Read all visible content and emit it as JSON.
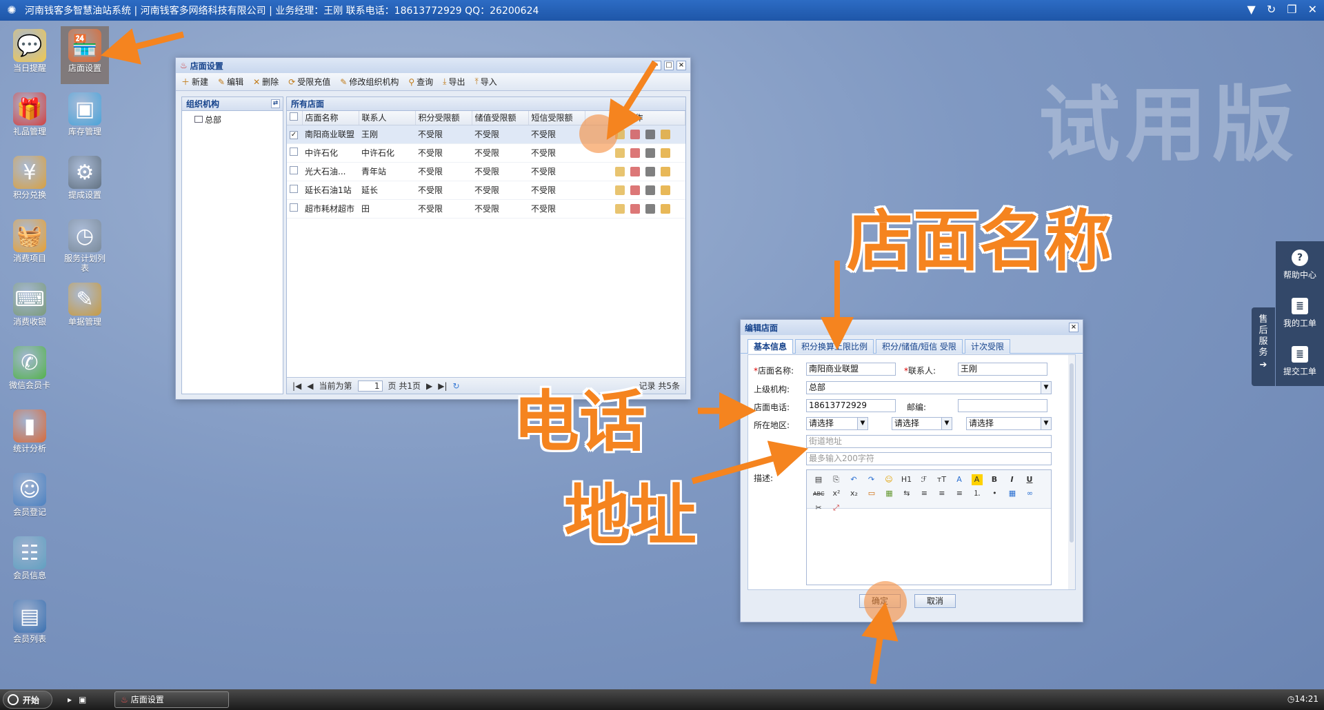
{
  "title_bar": {
    "text": "河南钱客多智慧油站系统 | 河南钱客多网络科技有限公司 | 业务经理：王刚 联系电话：18613772929 QQ：26200624"
  },
  "watermark": "试用版",
  "desktop_icons": [
    {
      "label": "当日提醒",
      "icon": "reminder-icon"
    },
    {
      "label": "店面设置",
      "icon": "store-icon"
    },
    {
      "label": "礼品管理",
      "icon": "gift-icon"
    },
    {
      "label": "库存管理",
      "icon": "inventory-icon"
    },
    {
      "label": "积分兑换",
      "icon": "points-exchange-icon"
    },
    {
      "label": "提成设置",
      "icon": "commission-icon"
    },
    {
      "label": "消费项目",
      "icon": "consume-item-icon"
    },
    {
      "label": "服务计划列表",
      "icon": "service-plan-icon"
    },
    {
      "label": "消费收银",
      "icon": "cashier-icon"
    },
    {
      "label": "单据管理",
      "icon": "receipt-icon"
    },
    {
      "label": "微信会员卡",
      "icon": "wechat-icon"
    },
    {
      "label": "统计分析",
      "icon": "stats-icon"
    },
    {
      "label": "会员登记",
      "icon": "member-register-icon"
    },
    {
      "label": "会员信息",
      "icon": "member-info-icon"
    },
    {
      "label": "会员列表",
      "icon": "member-list-icon"
    }
  ],
  "store_window": {
    "title": "店面设置",
    "toolbar": [
      "新建",
      "编辑",
      "删除",
      "受限充值",
      "修改组织机构",
      "查询",
      "导出",
      "导入"
    ],
    "org_panel_title": "组织机构",
    "org_root": "总部",
    "stores_panel_title": "所有店面",
    "columns": [
      "店面名称",
      "联系人",
      "积分受限额",
      "储值受限额",
      "短信受限额",
      "操作"
    ],
    "rows": [
      {
        "name": "南阳商业联盟",
        "contact": "王刚",
        "points": "不受限",
        "stored": "不受限",
        "sms": "不受限",
        "checked": "✓"
      },
      {
        "name": "中许石化",
        "contact": "中许石化",
        "points": "不受限",
        "stored": "不受限",
        "sms": "不受限",
        "checked": ""
      },
      {
        "name": "光大石油...",
        "contact": "青年站",
        "points": "不受限",
        "stored": "不受限",
        "sms": "不受限",
        "checked": ""
      },
      {
        "name": "延长石油1站",
        "contact": "延长",
        "points": "不受限",
        "stored": "不受限",
        "sms": "不受限",
        "checked": ""
      },
      {
        "name": "超市耗材超市",
        "contact": "田",
        "points": "不受限",
        "stored": "不受限",
        "sms": "不受限",
        "checked": ""
      }
    ],
    "pager": {
      "current_label": "当前为第",
      "page": "1",
      "total_label": "页 共1页",
      "record_info": "记录 共5条"
    }
  },
  "edit_window": {
    "title": "编辑店面",
    "tabs": [
      "基本信息",
      "积分换算上限比例",
      "积分/储值/短信 受限",
      "计次受限"
    ],
    "labels": {
      "store_name": "店面名称:",
      "contact": "联系人:",
      "parent_org": "上级机构:",
      "phone": "店面电话:",
      "zip": "邮编:",
      "region": "所在地区:",
      "description": "描述:"
    },
    "values": {
      "store_name": "南阳商业联盟",
      "contact": "王刚",
      "parent_org": "总部",
      "phone": "18613772929",
      "zip": "",
      "province": "请选择",
      "city": "请选择",
      "district": "请选择"
    },
    "placeholders": {
      "street": "街道地址",
      "remark": "最多输入200字符"
    },
    "editor_tools": [
      "H1",
      "B",
      "I",
      "U",
      "ABC",
      "x²",
      "x₂"
    ],
    "ok": "确定",
    "cancel": "取消"
  },
  "side_panel": {
    "tab": "售后服务",
    "items": [
      "帮助中心",
      "我的工单",
      "提交工单"
    ]
  },
  "annotations": {
    "store_name": "店面名称",
    "phone": "电话",
    "address": "地址"
  },
  "taskbar": {
    "start": "开始",
    "task": "店面设置",
    "time": "14:21"
  },
  "colors": {
    "accent_orange": "#f5841f",
    "titlebar_blue": "#1e56a8"
  }
}
